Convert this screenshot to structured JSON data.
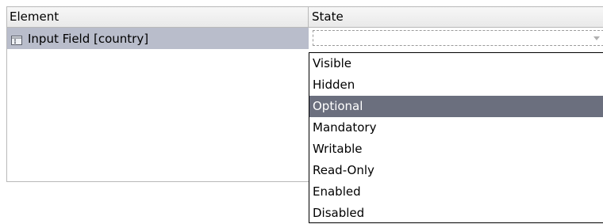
{
  "table": {
    "columns": [
      "Element",
      "State"
    ],
    "rows": [
      {
        "element": "Input Field [country]",
        "icon": "input-field-icon",
        "state_value": ""
      }
    ]
  },
  "dropdown": {
    "options": [
      "Visible",
      "Hidden",
      "Optional",
      "Mandatory",
      "Writable",
      "Read-Only",
      "Enabled",
      "Disabled"
    ],
    "highlighted": "Optional"
  },
  "colors": {
    "selected_row_bg": "#b9bdcb",
    "highlight_bg": "#6b6f7e",
    "highlight_fg": "#ffffff"
  }
}
